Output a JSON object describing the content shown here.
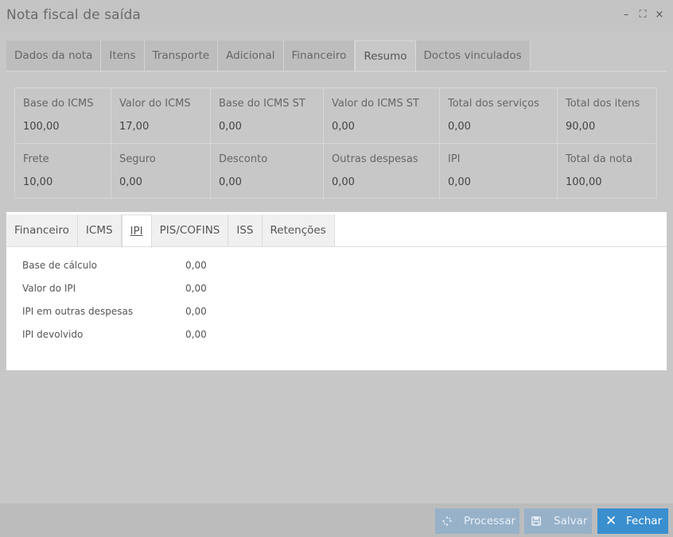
{
  "window": {
    "title": "Nota fiscal de saída",
    "controls": {
      "minimize": "–",
      "maximize": "⛶",
      "close": "×"
    }
  },
  "main_tabs": [
    {
      "label": "Dados da nota"
    },
    {
      "label": "Itens"
    },
    {
      "label": "Transporte"
    },
    {
      "label": "Adicional"
    },
    {
      "label": "Financeiro"
    },
    {
      "label": "Resumo"
    },
    {
      "label": "Doctos vinculados"
    }
  ],
  "main_tab_active": "Resumo",
  "totals": {
    "base_icms": {
      "label": "Base do ICMS",
      "value": "100,00"
    },
    "valor_icms": {
      "label": "Valor do ICMS",
      "value": "17,00"
    },
    "base_icms_st": {
      "label": "Base do ICMS ST",
      "value": "0,00"
    },
    "valor_icms_st": {
      "label": "Valor do ICMS ST",
      "value": "0,00"
    },
    "total_servicos": {
      "label": "Total dos serviços",
      "value": "0,00"
    },
    "total_itens": {
      "label": "Total dos itens",
      "value": "90,00"
    },
    "frete": {
      "label": "Frete",
      "value": "10,00"
    },
    "seguro": {
      "label": "Seguro",
      "value": "0,00"
    },
    "desconto": {
      "label": "Desconto",
      "value": "0,00"
    },
    "outras_despesas": {
      "label": "Outras despesas",
      "value": "0,00"
    },
    "ipi": {
      "label": "IPI",
      "value": "0,00"
    },
    "total_nota": {
      "label": "Total da nota",
      "value": "100,00"
    }
  },
  "sub_tabs": [
    {
      "label": "Financeiro"
    },
    {
      "label": "ICMS"
    },
    {
      "label": "IPI"
    },
    {
      "label": "PIS/COFINS"
    },
    {
      "label": "ISS"
    },
    {
      "label": "Retenções"
    }
  ],
  "sub_tab_active": "IPI",
  "ipi_fields": [
    {
      "label": "Base de cálculo",
      "value": "0,00"
    },
    {
      "label": "Valor do IPI",
      "value": "0,00"
    },
    {
      "label": "IPI em outras despesas",
      "value": "0,00"
    },
    {
      "label": "IPI devolvido",
      "value": "0,00"
    }
  ],
  "footer": {
    "processar": {
      "label": "Processar",
      "icon": "spinner-icon"
    },
    "salvar": {
      "label": "Salvar",
      "icon": "save-icon"
    },
    "fechar": {
      "label": "Fechar",
      "icon": "close-icon"
    }
  },
  "colors": {
    "accent": "#3a8fcf",
    "disabled_button": "#97b1c9",
    "overlay_gray": "#c7c7c7"
  }
}
